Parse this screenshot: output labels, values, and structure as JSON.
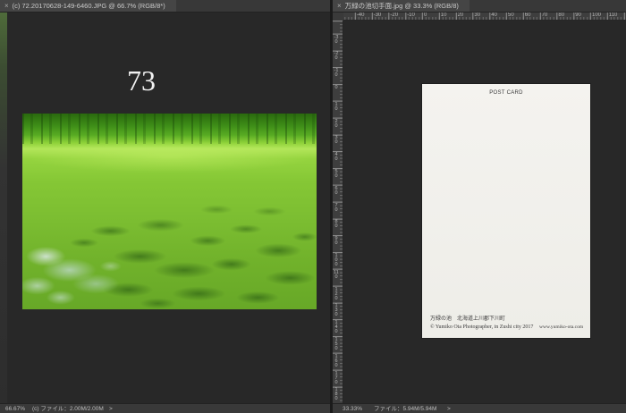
{
  "documents": {
    "left": {
      "tab": {
        "close_glyph": "×",
        "title": "(c) 72.20170628-149-6460.JPG @ 66.7% (RGB/8*)"
      },
      "canvas_text": "73",
      "status": {
        "zoom": "66.67%",
        "file_info": "(c) ファイル：2.00M/2.00M",
        "menu_arrow": ">"
      }
    },
    "right": {
      "tab": {
        "close_glyph": "×",
        "title": "万緑の池切手面.jpg @ 33.3% (RGB/8)"
      },
      "rulers": {
        "horizontal": [
          -40,
          -30,
          -20,
          -10,
          0,
          10,
          20,
          30,
          40,
          50,
          60,
          70,
          80,
          90,
          100,
          110
        ],
        "vertical": [
          -30,
          -20,
          -10,
          0,
          10,
          20,
          30,
          40,
          50,
          60,
          70,
          80,
          90,
          100,
          110,
          120,
          130,
          140,
          150,
          160,
          170,
          180
        ]
      },
      "postcard": {
        "header": "POST CARD",
        "caption": "万緑の池　北海道上川郡下川町",
        "credit": "© Yumiko Ota Photographer, in Zushi city 2017",
        "website": "www.yumiko-ota.com"
      },
      "status": {
        "zoom": "33.33%",
        "file_info": "ファイル：5.94M/5.94M",
        "menu_arrow": ">"
      }
    }
  },
  "icons": {
    "tab_close": "close-icon",
    "status_menu": "chevron-right-icon"
  },
  "colors": {
    "ui_chrome": "#3a3a3a",
    "canvas_background": "#282828",
    "ui_text": "#c9c9c9",
    "photo_green": "#7bbd31",
    "postcard_paper": "#f2f1ed"
  }
}
